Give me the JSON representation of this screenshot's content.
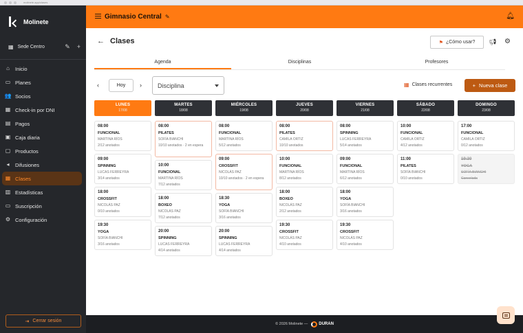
{
  "browser": {
    "url": "molinete.app/clases"
  },
  "sidebar": {
    "brand": "Molinete",
    "sede": "Sede Centro",
    "items": [
      {
        "label": "Inicio",
        "icon": "home-icon",
        "glyph": "⌂"
      },
      {
        "label": "Planes",
        "icon": "card-icon",
        "glyph": "▭"
      },
      {
        "label": "Socios",
        "icon": "users-icon",
        "glyph": "👥"
      },
      {
        "label": "Check-in por DNI",
        "icon": "qr-icon",
        "glyph": "▦"
      },
      {
        "label": "Pagos",
        "icon": "file-icon",
        "glyph": "▤"
      },
      {
        "label": "Caja diaria",
        "icon": "cash-icon",
        "glyph": "▣"
      },
      {
        "label": "Productos",
        "icon": "box-icon",
        "glyph": "▢"
      },
      {
        "label": "Difusiones",
        "icon": "megaphone-icon",
        "glyph": "◂"
      },
      {
        "label": "Clases",
        "icon": "calendar-icon",
        "glyph": "▦",
        "active": true
      },
      {
        "label": "Estadísticas",
        "icon": "chart-icon",
        "glyph": "▥"
      },
      {
        "label": "Suscripción",
        "icon": "wallet-icon",
        "glyph": "▭"
      },
      {
        "label": "Configuración",
        "icon": "gear-icon",
        "glyph": "⚙"
      }
    ],
    "logout": "Cerrar sesión"
  },
  "topbar": {
    "gym": "Gimnasio Central"
  },
  "page": {
    "title": "Clases",
    "how": "¿Cómo usar?",
    "tabs": [
      "Agenda",
      "Disciplinas",
      "Profesores"
    ],
    "today": "Hoy",
    "discipline_placeholder": "Disciplina",
    "recurring": "Clases recurrentes",
    "new_class": "Nueva clase"
  },
  "calendar": {
    "days": [
      {
        "name": "LUNES",
        "date": "17/08",
        "active": true,
        "classes": [
          {
            "time": "08:00",
            "name": "FUNCIONAL",
            "prof": "MARTINA RÍOS",
            "status": "2/12 anotados"
          },
          {
            "time": "09:00",
            "name": "SPINNING",
            "prof": "LUCAS FERREYRA",
            "status": "3/14 anotados"
          },
          {
            "time": "18:00",
            "name": "CROSSFIT",
            "prof": "NICOLÁS PAZ",
            "status": "0/10 anotados"
          },
          {
            "time": "19:30",
            "name": "YOGA",
            "prof": "SOFÍA BIANCHI",
            "status": "3/16 anotados"
          }
        ]
      },
      {
        "name": "MARTES",
        "date": "18/08",
        "classes": [
          {
            "time": "08:00",
            "name": "PILATES",
            "prof": "SOFÍA BIANCHI",
            "status": "10/10 anotados · 2 en espera",
            "tall": true,
            "hl": true
          },
          {
            "time": "10:00",
            "name": "FUNCIONAL",
            "prof": "MARTINA RÍOS",
            "status": "7/12 anotados"
          },
          {
            "time": "18:00",
            "name": "BOXEO",
            "prof": "NICOLÁS PAZ",
            "status": "7/12 anotados"
          },
          {
            "time": "20:00",
            "name": "SPINNING",
            "prof": "LUCAS FERREYRA",
            "status": "4/14 anotados"
          }
        ]
      },
      {
        "name": "MIÉRCOLES",
        "date": "19/08",
        "classes": [
          {
            "time": "08:00",
            "name": "FUNCIONAL",
            "prof": "MARTINA RÍOS",
            "status": "5/12 anotados"
          },
          {
            "time": "09:00",
            "name": "CROSSFIT",
            "prof": "NICOLÁS PAZ",
            "status": "10/10 anotados · 2 en espera",
            "tall": true,
            "hl": true
          },
          {
            "time": "18:30",
            "name": "YOGA",
            "prof": "SOFÍA BIANCHI",
            "status": "3/16 anotados"
          },
          {
            "time": "20:00",
            "name": "SPINNING",
            "prof": "LUCAS FERREYRA",
            "status": "4/14 anotados"
          }
        ]
      },
      {
        "name": "JUEVES",
        "date": "20/08",
        "classes": [
          {
            "time": "08:00",
            "name": "PILATES",
            "prof": "CAMILA ORTIZ",
            "status": "10/10 anotados",
            "hl": true
          },
          {
            "time": "10:00",
            "name": "FUNCIONAL",
            "prof": "MARTINA RÍOS",
            "status": "8/12 anotados"
          },
          {
            "time": "18:00",
            "name": "BOXEO",
            "prof": "NICOLÁS PAZ",
            "status": "2/12 anotados"
          },
          {
            "time": "19:30",
            "name": "CROSSFIT",
            "prof": "NICOLÁS PAZ",
            "status": "4/10 anotados"
          }
        ]
      },
      {
        "name": "VIERNES",
        "date": "21/08",
        "classes": [
          {
            "time": "08:00",
            "name": "SPINNING",
            "prof": "LUCAS FERREYRA",
            "status": "5/14 anotados"
          },
          {
            "time": "09:00",
            "name": "FUNCIONAL",
            "prof": "MARTINA RÍOS",
            "status": "6/12 anotados"
          },
          {
            "time": "18:00",
            "name": "YOGA",
            "prof": "SOFÍA BIANCHI",
            "status": "3/16 anotados"
          },
          {
            "time": "19:30",
            "name": "CROSSFIT",
            "prof": "NICOLÁS PAZ",
            "status": "4/10 anotados"
          }
        ]
      },
      {
        "name": "SÁBADO",
        "date": "22/08",
        "classes": [
          {
            "time": "10:00",
            "name": "FUNCIONAL",
            "prof": "CAMILA ORTIZ",
            "status": "4/12 anotados"
          },
          {
            "time": "11:00",
            "name": "PILATES",
            "prof": "SOFÍA BIANCHI",
            "status": "0/10 anotados"
          }
        ]
      },
      {
        "name": "DOMINGO",
        "date": "23/08",
        "classes": [
          {
            "time": "17:00",
            "name": "FUNCIONAL",
            "prof": "CAMILA ORTIZ",
            "status": "0/12 anotados"
          },
          {
            "time": "19:30",
            "name": "YOGA",
            "prof": "SOFÍA BIANCHI",
            "status": "Cancelada",
            "cancel": true
          }
        ]
      }
    ]
  },
  "footer": {
    "copy": "© 2026 Molinete —",
    "logo": "DURAN"
  },
  "colors": {
    "accent": "#ff7a12",
    "sidebar": "#25272b",
    "active_nav_bg": "#5a3416"
  }
}
